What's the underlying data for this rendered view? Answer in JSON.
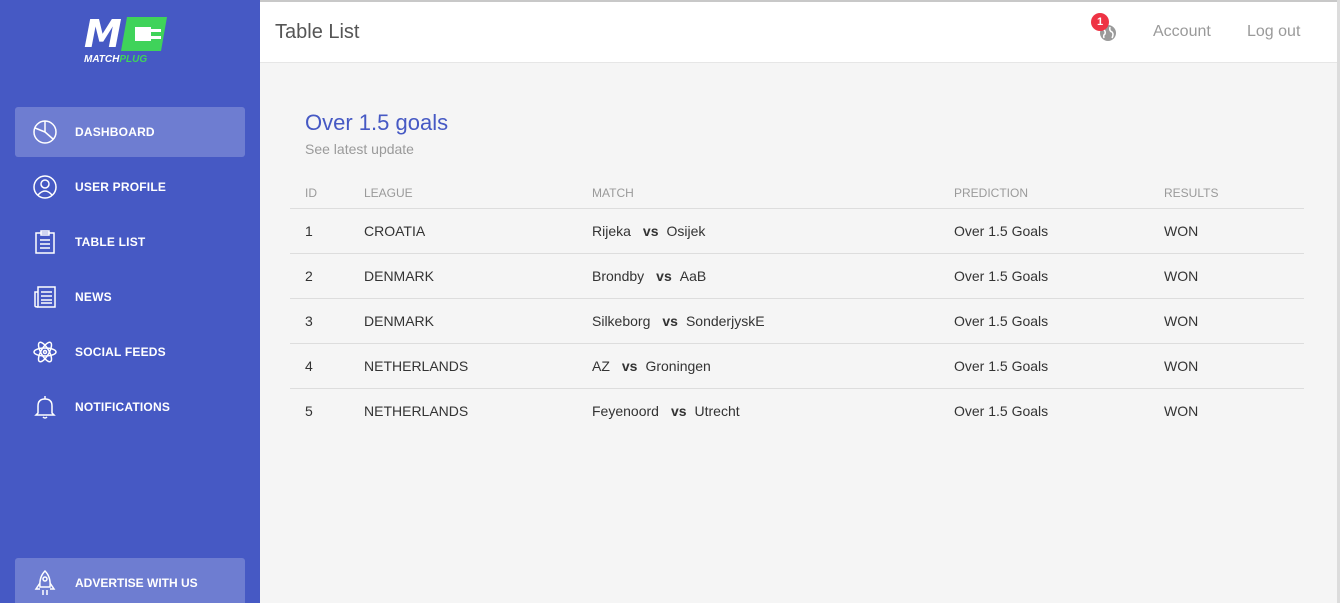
{
  "brand": {
    "logo_text": "M",
    "name_part1": "MATCH",
    "name_part2": "PLUG"
  },
  "sidebar": {
    "items": [
      {
        "label": "DASHBOARD",
        "icon": "pie-chart-icon",
        "active": true
      },
      {
        "label": "USER PROFILE",
        "icon": "user-icon",
        "active": false
      },
      {
        "label": "TABLE LIST",
        "icon": "clipboard-icon",
        "active": false
      },
      {
        "label": "NEWS",
        "icon": "newspaper-icon",
        "active": false
      },
      {
        "label": "SOCIAL FEEDS",
        "icon": "atom-icon",
        "active": false
      },
      {
        "label": "NOTIFICATIONS",
        "icon": "bell-icon",
        "active": false
      }
    ],
    "advertise": {
      "label": "ADVERTISE WITH US",
      "icon": "rocket-icon"
    }
  },
  "header": {
    "title": "Table List",
    "notification_count": "1",
    "account_label": "Account",
    "logout_label": "Log out"
  },
  "main": {
    "title": "Over 1.5 goals",
    "subtitle": "See latest update",
    "columns": [
      "ID",
      "LEAGUE",
      "MATCH",
      "PREDICTION",
      "RESULTS"
    ],
    "vs_label": "vs",
    "rows": [
      {
        "id": "1",
        "league": "CROATIA",
        "home": "Rijeka",
        "away": "Osijek",
        "prediction": "Over 1.5 Goals",
        "result": "WON"
      },
      {
        "id": "2",
        "league": "DENMARK",
        "home": "Brondby",
        "away": "AaB",
        "prediction": "Over 1.5 Goals",
        "result": "WON"
      },
      {
        "id": "3",
        "league": "DENMARK",
        "home": "Silkeborg",
        "away": "SonderjyskE",
        "prediction": "Over 1.5 Goals",
        "result": "WON"
      },
      {
        "id": "4",
        "league": "NETHERLANDS",
        "home": "AZ",
        "away": "Groningen",
        "prediction": "Over 1.5 Goals",
        "result": "WON"
      },
      {
        "id": "5",
        "league": "NETHERLANDS",
        "home": "Feyenoord",
        "away": "Utrecht",
        "prediction": "Over 1.5 Goals",
        "result": "WON"
      }
    ]
  },
  "colors": {
    "sidebar": "#4659c4",
    "accent": "#4659c4",
    "logo_green": "#3fd35a",
    "badge": "#ee3344"
  }
}
